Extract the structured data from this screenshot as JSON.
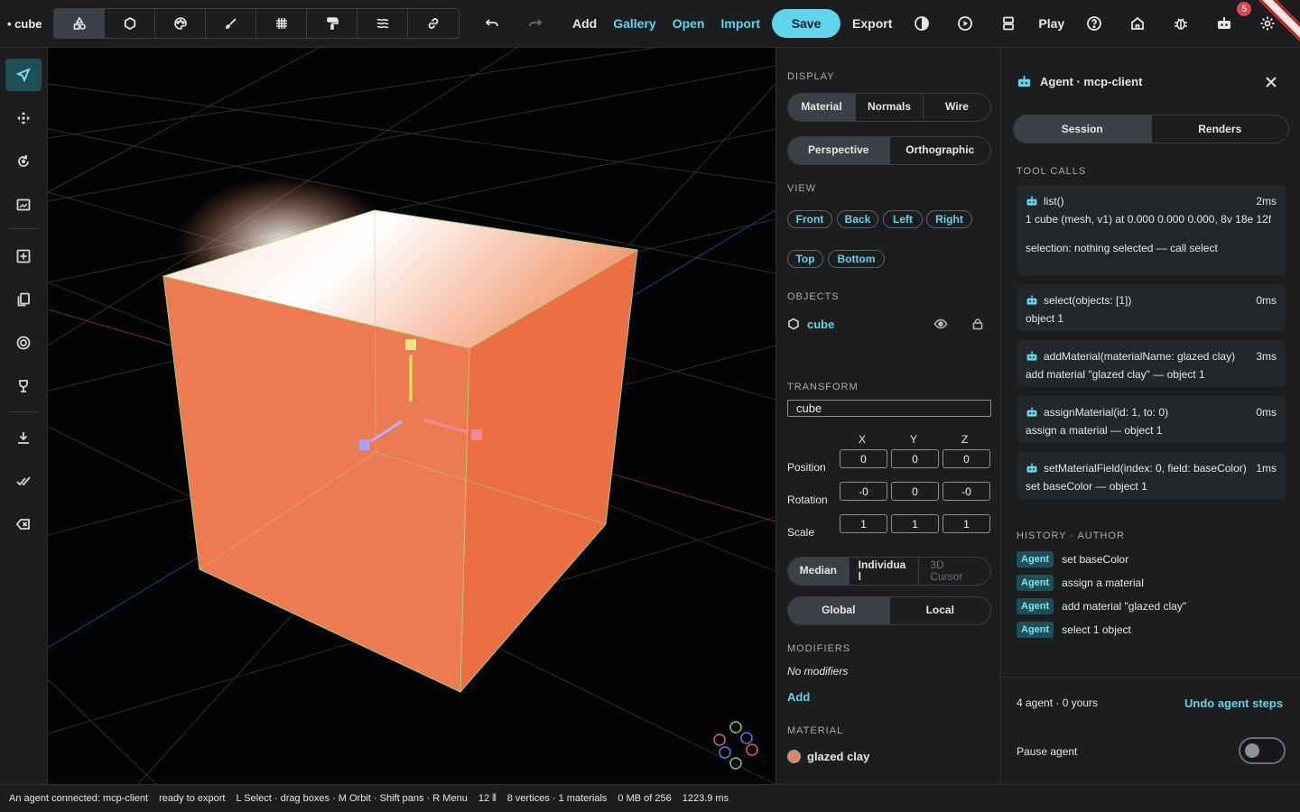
{
  "header": {
    "doc_title": "• cube",
    "mode_icons": [
      "shapes-icon",
      "circle-icon",
      "palette-icon",
      "brush-icon",
      "grid-icon",
      "paint-roller-icon",
      "layers-icon",
      "link-icon"
    ],
    "undo_icon": "undo-icon",
    "redo_icon": "redo-icon",
    "add": "Add",
    "gallery": "Gallery",
    "open": "Open",
    "import": "Import",
    "save": "Save",
    "export": "Export",
    "play": "Play",
    "notification_count": "5",
    "accent": "#5fd4ea"
  },
  "tools": [
    "select-arrow-icon",
    "move-icon",
    "rotate-icon",
    "frame-icon",
    "add-box-icon",
    "duplicate-icon",
    "target-icon",
    "trophy-icon",
    "download-icon",
    "check-all-icon",
    "delete-icon"
  ],
  "props": {
    "display_label": "DISPLAY",
    "display_modes": [
      "Material",
      "Normals",
      "Wire"
    ],
    "projections": [
      "Perspective",
      "Orthographic"
    ],
    "view_label": "VIEW",
    "views": [
      "Front",
      "Back",
      "Left",
      "Right",
      "Top",
      "Bottom"
    ],
    "objects_label": "OBJECTS",
    "object_name": "cube",
    "transform_label": "TRANSFORM",
    "transform_name": "cube",
    "axes": [
      "X",
      "Y",
      "Z"
    ],
    "position_label": "Position",
    "position": [
      "0",
      "0",
      "0"
    ],
    "rotation_label": "Rotation",
    "rotation": [
      "-0",
      "0",
      "-0"
    ],
    "scale_label": "Scale",
    "scale": [
      "1",
      "1",
      "1"
    ],
    "pivot_median": "Median",
    "pivot_individual": "Individua\nl",
    "pivot_cursor": "3D\nCursor",
    "space_global": "Global",
    "space_local": "Local",
    "modifiers_label": "MODIFIERS",
    "no_modifiers": "No modifiers",
    "add_modifier": "Add",
    "material_label": "MATERIAL",
    "material_name": "glazed clay",
    "material_color": "#f07f52"
  },
  "agent": {
    "title": "Agent · mcp-client",
    "tabs": [
      "Session",
      "Renders"
    ],
    "tool_calls_label": "TOOL CALLS",
    "tool_calls": [
      {
        "fn": "list()",
        "ms": "2ms",
        "out": "1 cube (mesh, v1) at 0.000 0.000 0.000, 8v 18e 12f",
        "out2": "selection: nothing selected — call select"
      },
      {
        "fn": "select(objects: [1])",
        "ms": "0ms",
        "out": "object 1"
      },
      {
        "fn": "addMaterial(materialName: glazed clay)",
        "ms": "3ms",
        "out": "add material \"glazed clay\" — object 1"
      },
      {
        "fn": "assignMaterial(id: 1, to: 0)",
        "ms": "0ms",
        "out": "assign a material — object 1"
      },
      {
        "fn": "setMaterialField(index: 0, field: baseColor)",
        "ms": "1ms",
        "out": "set baseColor — object 1"
      }
    ],
    "history_label": "HISTORY · AUTHOR",
    "history_tag": "Agent",
    "history": [
      "set baseColor",
      "assign a material",
      "add material \"glazed clay\"",
      "select 1 object"
    ],
    "summary": "4 agent · 0 yours",
    "undo": "Undo agent steps",
    "pause": "Pause agent",
    "paused": false
  },
  "status": {
    "connected": "An agent connected: mcp-client",
    "export": "ready to export",
    "hints": "L Select · drag boxes · M Orbit · Shift pans · R Menu",
    "fps": "12 ⫴",
    "mesh": "8 vertices · 1 materials",
    "memory": "0 MB of 256",
    "time": "1223.9 ms"
  }
}
